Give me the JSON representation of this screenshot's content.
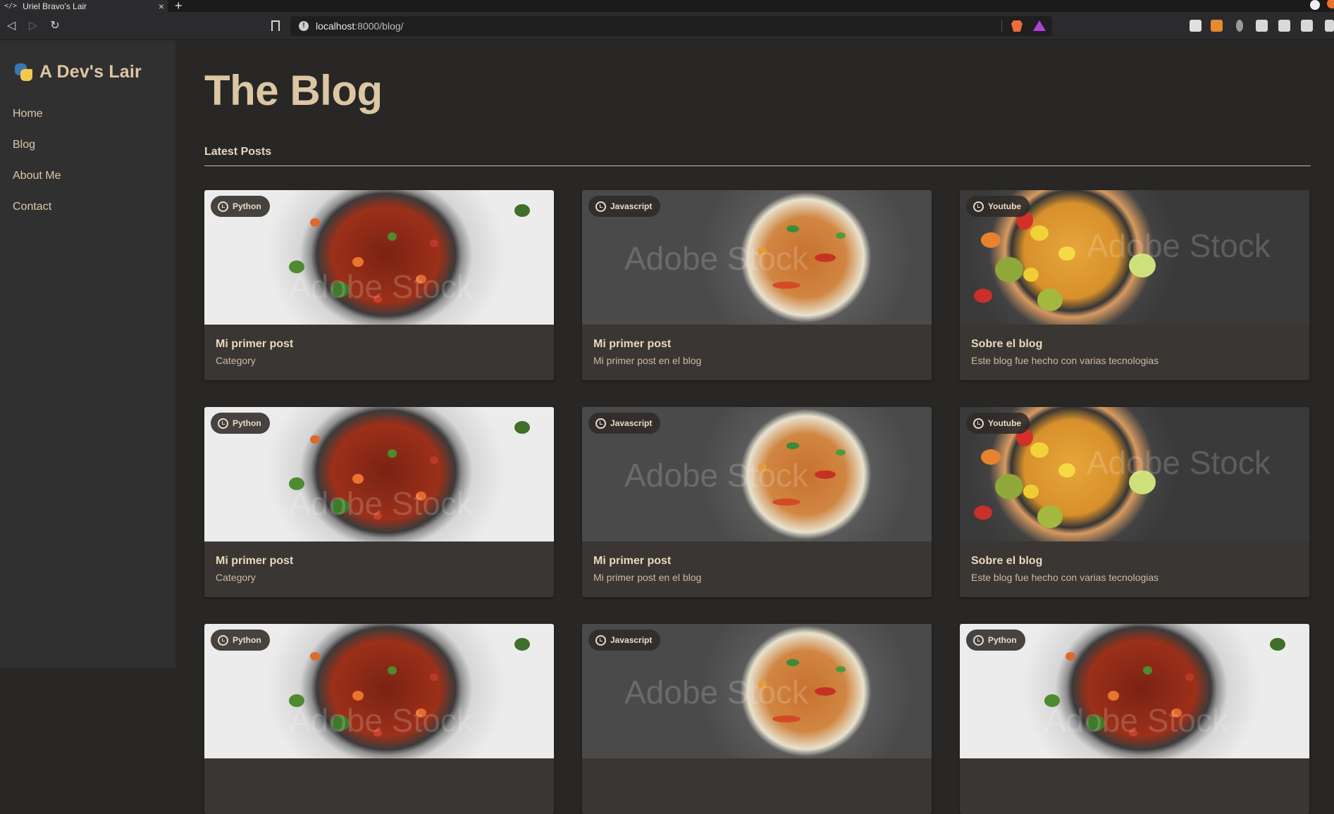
{
  "browser": {
    "tab_title": "Uriel Bravo's Lair",
    "tab_code_glyph": "</>",
    "close_glyph": "×",
    "new_tab_glyph": "+",
    "url_host": "localhost",
    "url_rest": ":8000/blog/"
  },
  "sidebar": {
    "brand": "A Dev's Lair",
    "items": [
      {
        "label": "Home"
      },
      {
        "label": "Blog"
      },
      {
        "label": "About Me"
      },
      {
        "label": "Contact"
      }
    ]
  },
  "main": {
    "title": "The Blog",
    "section_title": "Latest Posts"
  },
  "posts": [
    {
      "tag": "Python",
      "title": "Mi primer post",
      "desc": "Category",
      "image": "beans"
    },
    {
      "tag": "Javascript",
      "title": "Mi primer post",
      "desc": "Mi primer post en el blog",
      "image": "noodles"
    },
    {
      "tag": "Youtube",
      "title": "Sobre el blog",
      "desc": "Este blog fue hecho con varias tecnologias",
      "image": "curry"
    },
    {
      "tag": "Python",
      "title": "Mi primer post",
      "desc": "Category",
      "image": "beans"
    },
    {
      "tag": "Javascript",
      "title": "Mi primer post",
      "desc": "Mi primer post en el blog",
      "image": "noodles"
    },
    {
      "tag": "Youtube",
      "title": "Sobre el blog",
      "desc": "Este blog fue hecho con varias tecnologias",
      "image": "curry"
    },
    {
      "tag": "Python",
      "title": "",
      "desc": "",
      "image": "beans"
    },
    {
      "tag": "Javascript",
      "title": "",
      "desc": "",
      "image": "noodles"
    },
    {
      "tag": "Python",
      "title": "",
      "desc": "",
      "image": "beans"
    }
  ],
  "watermark": "Adobe Stock",
  "colors": {
    "accent": "#dcc6a3",
    "sidebar_bg": "#313030",
    "page_bg": "#282726",
    "card_bg": "#3a3633"
  }
}
